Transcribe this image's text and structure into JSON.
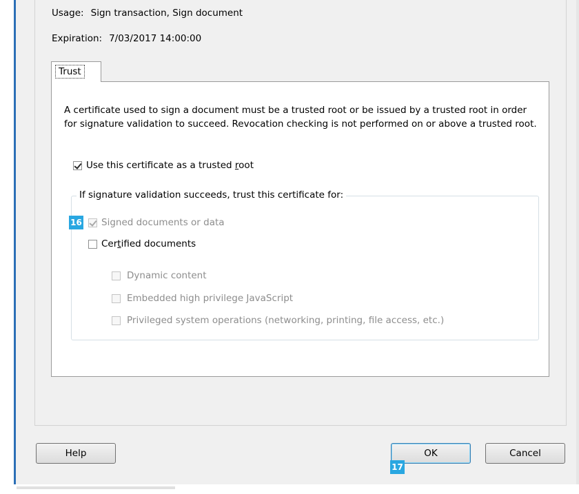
{
  "certificate": {
    "usage_label": "Usage:",
    "usage_value": "Sign transaction, Sign document",
    "expiration_label": "Expiration:",
    "expiration_value": "7/03/2017 14:00:00"
  },
  "tabs": [
    {
      "label": "Trust",
      "selected": true
    }
  ],
  "trust": {
    "description": "A certificate used to sign a document must be a trusted root or be issued by a trusted root in order for signature validation to succeed.  Revocation checking is not performed on or above a trusted root.",
    "trusted_root": {
      "label_before": "Use this certificate as a trusted ",
      "label_underlined": "r",
      "label_after": "oot",
      "checked": true
    },
    "group_title": "If signature validation succeeds, trust this certificate for:",
    "options": [
      {
        "id": "signed",
        "label": "Signed documents or data",
        "checked": true,
        "disabled": true
      },
      {
        "id": "certified",
        "label_before": "Cer",
        "label_underlined": "t",
        "label_after": "ified documents",
        "checked": false,
        "disabled": false
      },
      {
        "id": "dynamic",
        "label": "Dynamic content",
        "checked": false,
        "disabled": true
      },
      {
        "id": "embedded",
        "label": "Embedded high privilege JavaScript",
        "checked": false,
        "disabled": true
      },
      {
        "id": "privileged",
        "label": "Privileged system operations (networking, printing, file access, etc.)",
        "checked": false,
        "disabled": true
      }
    ]
  },
  "badges": {
    "first": "16",
    "second": "17"
  },
  "buttons": {
    "help": "Help",
    "ok": "OK",
    "cancel": "Cancel"
  },
  "colors": {
    "badge": "#29a7e1",
    "window_border": "#2b6fb6",
    "dialog_bg": "#f0f0f0"
  }
}
